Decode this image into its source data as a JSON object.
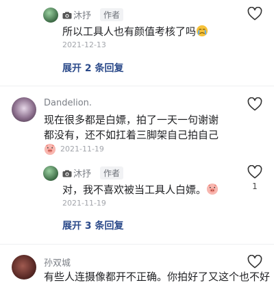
{
  "comments": [
    {
      "reply": {
        "username": "沐抒",
        "tag": "作者",
        "text": "所以工具人也有颜值考核了吗",
        "emoji": "crying-face-emoji",
        "date": "2021-12-13"
      },
      "expand_label": "展开 2 条回复"
    },
    {
      "username": "Dandelion.",
      "text_line1": "现在很多都是白嫖，拍了一天一句谢谢",
      "text_line2": "都没有，还不如扛着三脚架自己拍自己",
      "emoji": "pig-face-emoji",
      "date": "2021-11-19",
      "reply": {
        "username": "沐抒",
        "tag": "作者",
        "text": "对，我不喜欢被当工具人白嫖。",
        "emoji": "pig-face-emoji",
        "date": "2021-11-19",
        "like_count": "1"
      },
      "expand_label": "展开 3 条回复"
    },
    {
      "username": "孙双城",
      "text_partial": "有些人连摄像都开不正确。你拍好了又这个也不好"
    }
  ],
  "colors": {
    "link": "#2b4a8a",
    "meta": "#a2a5ab"
  }
}
